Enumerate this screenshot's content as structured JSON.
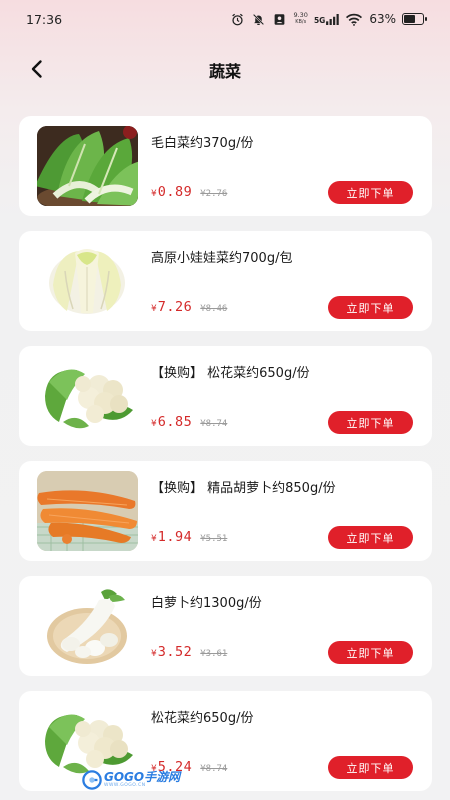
{
  "status_bar": {
    "time": "17:36",
    "net_speed_value": "9.30",
    "net_speed_unit": "KB/s",
    "network": "5G",
    "battery_percent": "63%",
    "battery_level": 0.63
  },
  "header": {
    "title": "蔬菜",
    "back_icon": "chevron-left-icon"
  },
  "colors": {
    "accent": "#e0202a",
    "price": "#d42a2a"
  },
  "products": [
    {
      "name": "毛白菜约370g/份",
      "currency": "¥",
      "price": "0.89",
      "old_price": "¥2.76",
      "button": "立即下单",
      "image": "bok-choy"
    },
    {
      "name": "高原小娃娃菜约700g/包",
      "currency": "¥",
      "price": "7.26",
      "old_price": "¥8.46",
      "button": "立即下单",
      "image": "baby-cabbage"
    },
    {
      "name": "【换购】 松花菜约650g/份",
      "currency": "¥",
      "price": "6.85",
      "old_price": "¥8.74",
      "button": "立即下单",
      "image": "cauliflower"
    },
    {
      "name": "【换购】 精品胡萝卜约850g/份",
      "currency": "¥",
      "price": "1.94",
      "old_price": "¥5.51",
      "button": "立即下单",
      "image": "carrot"
    },
    {
      "name": "白萝卜约1300g/份",
      "currency": "¥",
      "price": "3.52",
      "old_price": "¥3.61",
      "button": "立即下单",
      "image": "white-radish"
    },
    {
      "name": "松花菜约650g/份",
      "currency": "¥",
      "price": "5.24",
      "old_price": "¥8.74",
      "button": "立即下单",
      "image": "cauliflower"
    }
  ],
  "watermark": {
    "brand": "GOGO手游网",
    "url": "WWW.GOGO.CN"
  }
}
